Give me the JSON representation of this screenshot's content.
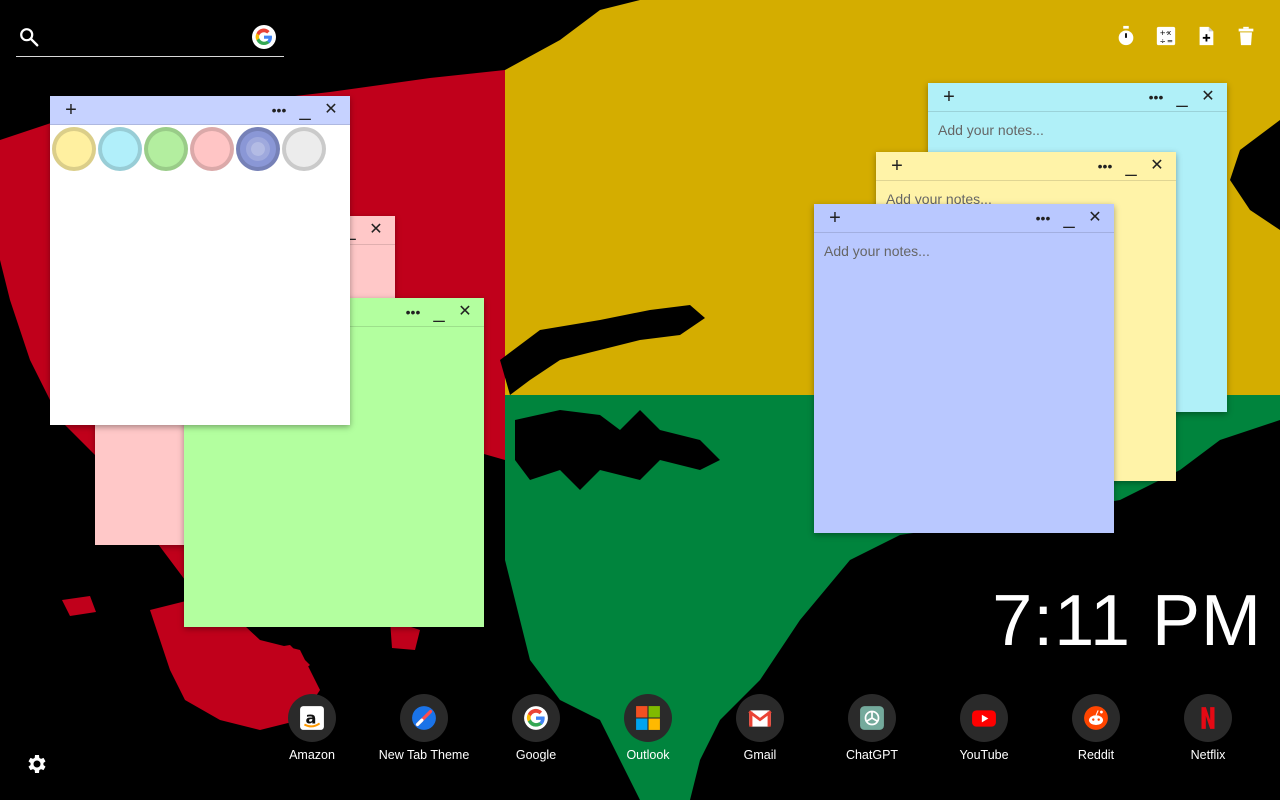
{
  "search": {
    "placeholder": "",
    "value": "",
    "engine_icon": "google-icon"
  },
  "tools": [
    {
      "name": "timer-icon"
    },
    {
      "name": "calculator-icon"
    },
    {
      "name": "add-note-icon"
    },
    {
      "name": "trash-icon"
    }
  ],
  "notes": {
    "add_symbol": "+",
    "menu_symbol": "•••",
    "minimize_symbol": "_",
    "close_symbol": "✕",
    "placeholder": "Add your notes...",
    "colors": {
      "white": "#ffffff",
      "pink": "#ffc8c8",
      "green": "#b3ff9f",
      "cyan": "#b0f0f8",
      "yellow": "#fff3a8",
      "blue": "#b9c8ff",
      "picker_bar": "#c6d2ff"
    },
    "palette": [
      {
        "name": "yellow-swatch",
        "color": "#fff0a0"
      },
      {
        "name": "cyan-swatch",
        "color": "#b1effa"
      },
      {
        "name": "green-swatch",
        "color": "#b3ee9f"
      },
      {
        "name": "pink-swatch",
        "color": "#ffc5c5"
      },
      {
        "name": "blue-swatch",
        "color": "#8a97d6",
        "selected": true
      },
      {
        "name": "gray-swatch",
        "color": "#ececec"
      }
    ]
  },
  "clock": {
    "time": "7:11 PM"
  },
  "shortcuts": [
    {
      "label": "Amazon",
      "icon": "amazon-icon"
    },
    {
      "label": "New Tab Theme",
      "icon": "new-tab-theme-icon"
    },
    {
      "label": "Google",
      "icon": "google-icon"
    },
    {
      "label": "Outlook",
      "icon": "outlook-icon"
    },
    {
      "label": "Gmail",
      "icon": "gmail-icon"
    },
    {
      "label": "ChatGPT",
      "icon": "chatgpt-icon"
    },
    {
      "label": "YouTube",
      "icon": "youtube-icon"
    },
    {
      "label": "Reddit",
      "icon": "reddit-icon"
    },
    {
      "label": "Netflix",
      "icon": "netflix-icon"
    }
  ],
  "settings": {
    "icon": "gear-icon"
  },
  "background": {
    "red": "#c0001b",
    "yellow": "#d4ad00",
    "green": "#00843d",
    "black": "#000000"
  }
}
